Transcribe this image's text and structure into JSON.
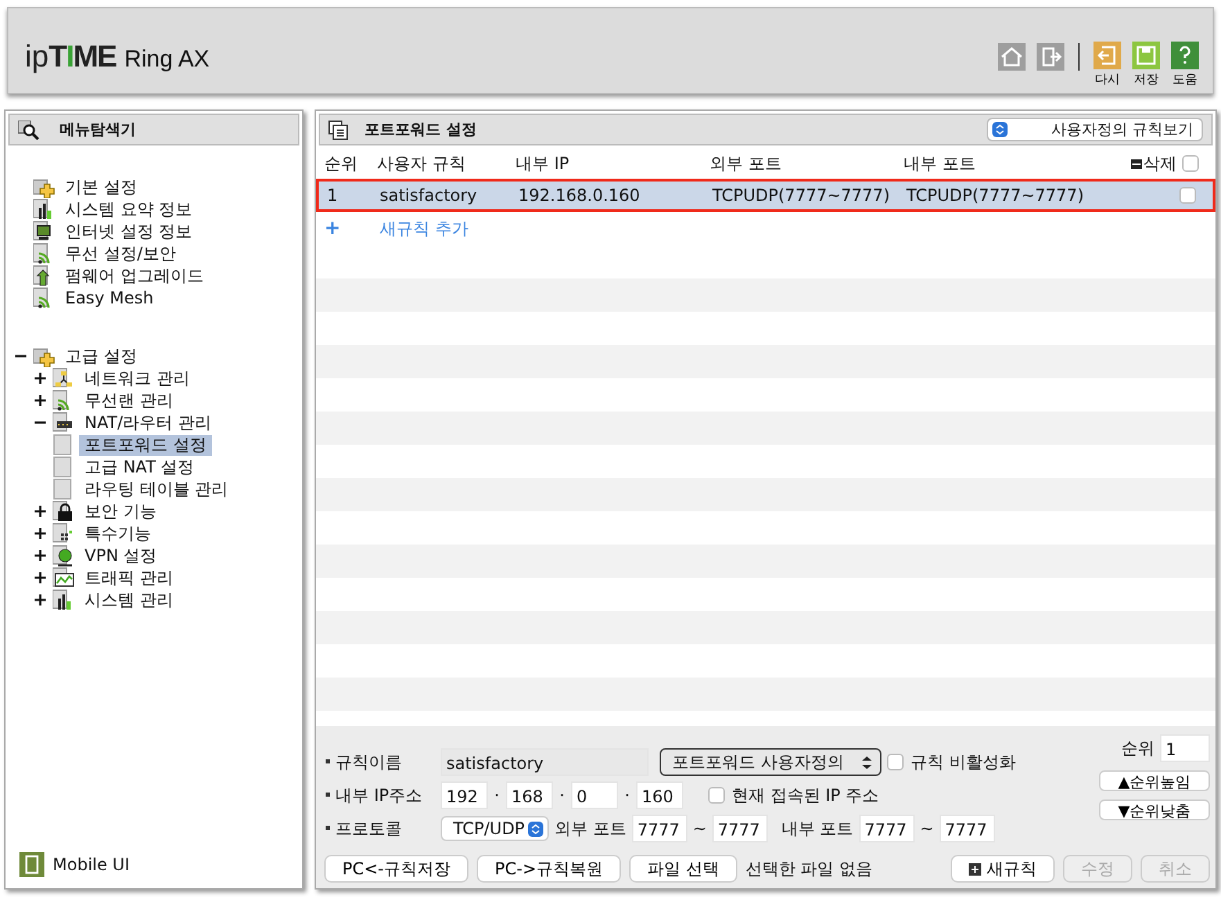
{
  "header": {
    "logo_prefix": "ip",
    "logo_brand": "TIME",
    "model": "Ring AX",
    "tools": [
      {
        "kind": "home"
      },
      {
        "kind": "logout"
      }
    ],
    "actions": [
      {
        "kind": "undo",
        "label": "다시"
      },
      {
        "kind": "save",
        "label": "저장"
      },
      {
        "kind": "help",
        "label": "도움"
      }
    ]
  },
  "sidebar": {
    "title": "메뉴탐색기",
    "tree": [
      {
        "label": "기본 설정",
        "kind": "folder-plus",
        "children": [
          {
            "label": "시스템 요약 정보",
            "kind": "chart"
          },
          {
            "label": "인터넷 설정 정보",
            "kind": "monitor"
          },
          {
            "label": "무선 설정/보안",
            "kind": "wifi"
          },
          {
            "label": "펌웨어 업그레이드",
            "kind": "upload"
          },
          {
            "label": "Easy Mesh",
            "kind": "wifi"
          }
        ]
      },
      {
        "label": "고급 설정",
        "kind": "folder-plus",
        "expanded": true,
        "children": [
          {
            "label": "네트워크 관리",
            "kind": "network",
            "expanded": false
          },
          {
            "label": "무선랜 관리",
            "kind": "wifi",
            "expanded": false
          },
          {
            "label": "NAT/라우터 관리",
            "kind": "router",
            "expanded": true,
            "children": [
              {
                "label": "포트포워드 설정",
                "kind": "page",
                "selected": true
              },
              {
                "label": "고급 NAT 설정",
                "kind": "page",
                "selected": false
              },
              {
                "label": "라우팅 테이블 관리",
                "kind": "page",
                "selected": false
              }
            ]
          },
          {
            "label": "보안 기능",
            "kind": "lock",
            "expanded": false
          },
          {
            "label": "특수기능",
            "kind": "dots",
            "expanded": false
          },
          {
            "label": "VPN 설정",
            "kind": "globe",
            "expanded": false
          },
          {
            "label": "트래픽 관리",
            "kind": "traffic",
            "expanded": false
          },
          {
            "label": "시스템 관리",
            "kind": "chart",
            "expanded": false
          }
        ]
      }
    ],
    "footer_link": "Mobile UI"
  },
  "panel": {
    "title": "포트포워드 설정",
    "view_select": "사용자정의 규칙보기",
    "table": {
      "columns": [
        "순위",
        "사용자 규칙",
        "내부 IP",
        "외부 포트",
        "내부 포트"
      ],
      "delete_column": "삭제",
      "delete_all_checked": false,
      "rows": [
        {
          "cells": [
            "1",
            "satisfactory",
            "192.168.0.160",
            "TCPUDP(7777~7777)",
            "TCPUDP(7777~7777)"
          ],
          "selected": true,
          "checked": false
        }
      ],
      "add_row": {
        "icon": "+",
        "label": "새규칙 추가"
      }
    },
    "form": {
      "name_label": "규칙이름",
      "name_value": "satisfactory",
      "preset": "포트포워드 사용자정의",
      "disable_rule": {
        "label": "규칙 비활성화",
        "checked": false
      },
      "rank_label": "순위",
      "rank_value": "1",
      "rank_up": "▲순위높임",
      "rank_down": "▼순위낮춤",
      "ip_label": "내부 IP주소",
      "ip_parts": [
        "192",
        "168",
        "0",
        "160"
      ],
      "ip_separator": "·",
      "current_ip": {
        "label": "현재 접속된 IP 주소",
        "checked": false
      },
      "protocol_label": "프로토콜",
      "protocol": "TCP/UDP",
      "ext_port_label": "외부 포트",
      "ext_port": [
        "7777",
        "7777"
      ],
      "int_port_label": "내부 포트",
      "int_port": [
        "7777",
        "7777"
      ],
      "range_separator": "~"
    },
    "bottom_buttons": [
      {
        "label": "PC<-규칙저장"
      },
      {
        "label": "PC->규칙복원"
      },
      {
        "label": "파일 선택"
      }
    ],
    "file_status": "선택한 파일 없음",
    "action_buttons": [
      {
        "label": "새규칙",
        "kind": "new",
        "disabled": false
      },
      {
        "label": "수정",
        "kind": "plain",
        "disabled": true
      },
      {
        "label": "취소",
        "kind": "plain",
        "disabled": true
      }
    ]
  }
}
